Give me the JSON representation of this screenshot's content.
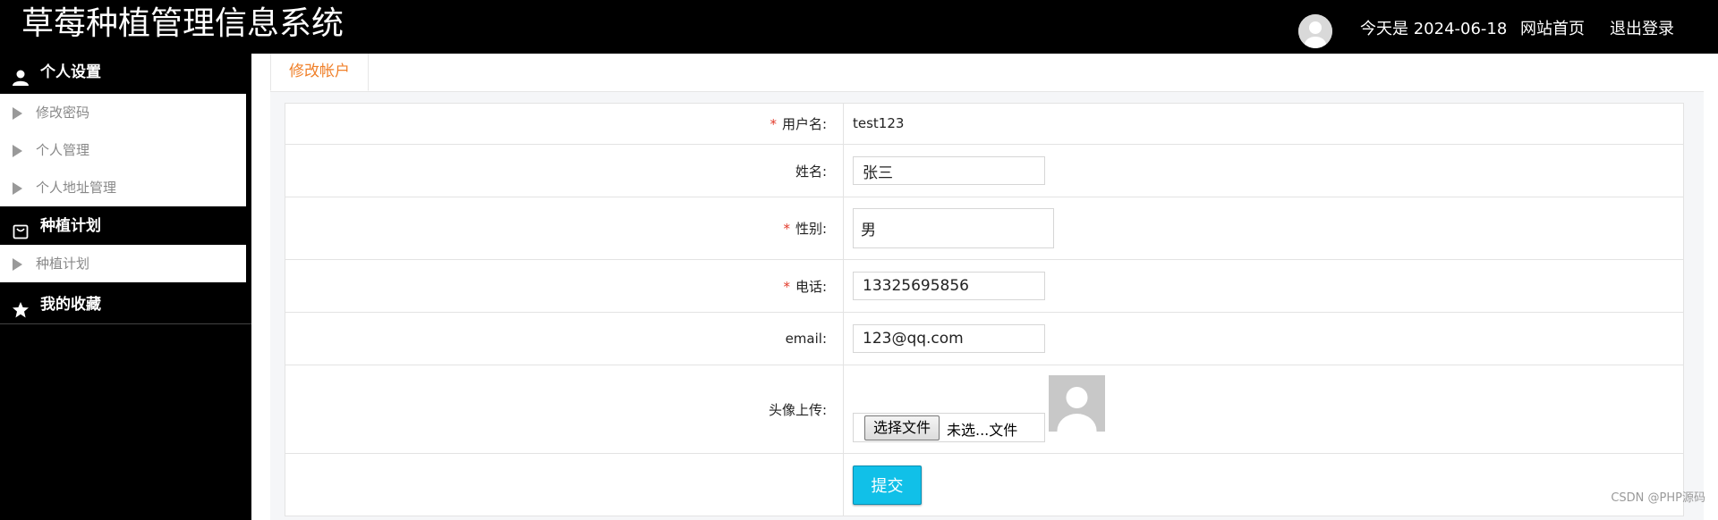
{
  "header": {
    "title": "草莓种植管理信息系统",
    "date_text": "今天是 2024-06-18",
    "home_link": "网站首页",
    "logout_link": "退出登录"
  },
  "sidebar": {
    "groups": [
      {
        "label": "个人设置",
        "icon": "user-icon",
        "items": [
          "修改密码",
          "个人管理",
          "个人地址管理"
        ]
      },
      {
        "label": "种植计划",
        "icon": "bag-icon",
        "items": [
          "种植计划"
        ]
      },
      {
        "label": "我的收藏",
        "icon": "star-icon",
        "items": []
      }
    ]
  },
  "tabs": [
    {
      "label": "修改帐户",
      "active": true
    }
  ],
  "form": {
    "username": {
      "label": "用户名:",
      "required": true,
      "value": "test123"
    },
    "name": {
      "label": "姓名:",
      "required": false,
      "value": "张三"
    },
    "gender": {
      "label": "性别:",
      "required": true,
      "value": "男"
    },
    "phone": {
      "label": "电话:",
      "required": true,
      "value": "13325695856"
    },
    "email": {
      "label": "email:",
      "required": false,
      "value": "123@qq.com"
    },
    "avatar": {
      "label": "头像上传:",
      "button_label": "选择文件",
      "status_text": "未选...文件"
    },
    "submit_label": "提交"
  },
  "colors": {
    "header_bg": "#000000",
    "sidebar_bg": "#000000",
    "tab_active_text": "#f0802a",
    "required_mark": "#e23a2a",
    "submit_bg": "#11c0e8"
  },
  "watermark": "CSDN @PHP源码"
}
